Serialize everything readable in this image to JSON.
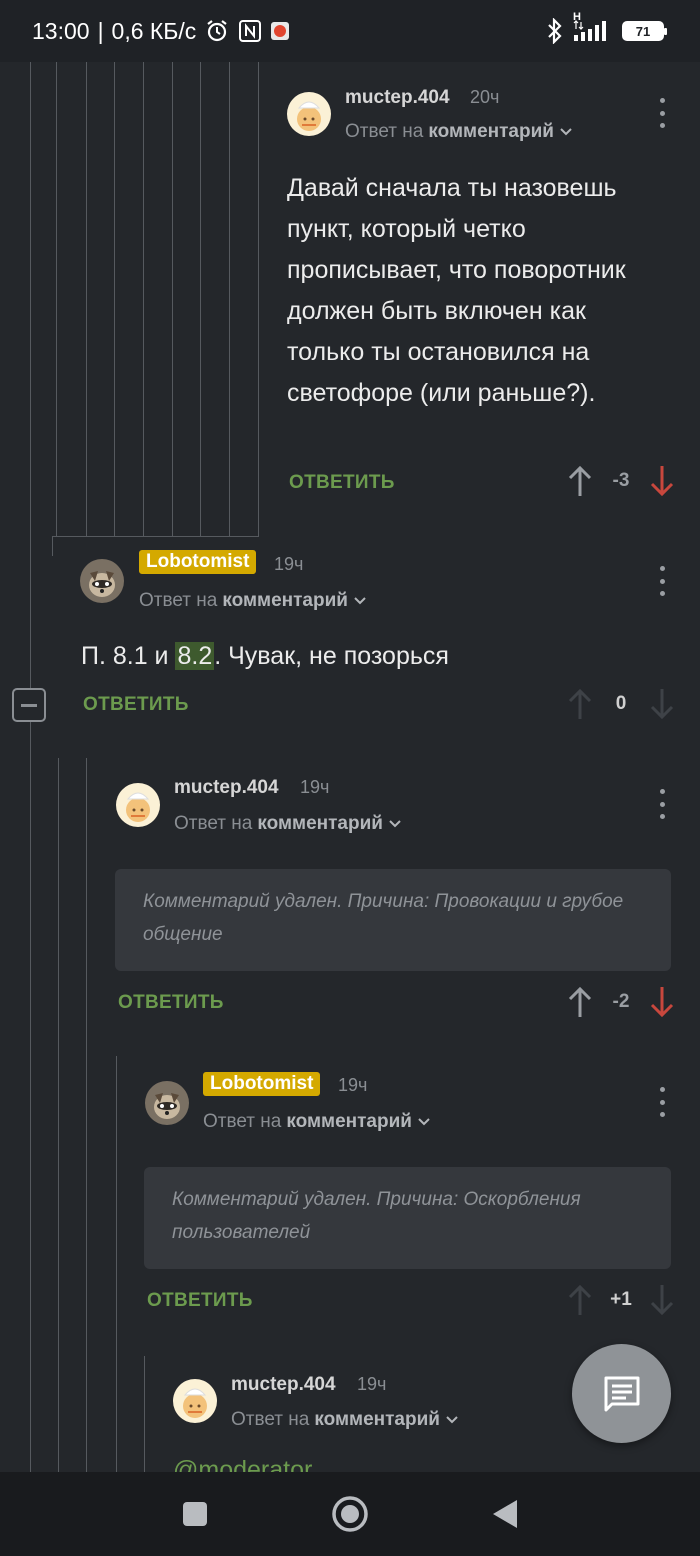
{
  "status_bar": {
    "time": "13:00",
    "network_speed": "0,6 КБ/с",
    "signal_label": "H",
    "battery": "71"
  },
  "comments": [
    {
      "username": "muctep.404",
      "time": "20ч",
      "reply_to_prefix": "Ответ на",
      "reply_to_link": "комментарий",
      "text": "Давай сначала ты назовешь пункт, который четко прописывает, что поворотник должен быть включен как только ты остановился на светофоре (или раньше?).",
      "reply_label": "ОТВЕТИТЬ",
      "score": "-3"
    },
    {
      "username": "Lobotomist",
      "time": "19ч",
      "reply_to_prefix": "Ответ на",
      "reply_to_link": "комментарий",
      "text_before": "П. 8.1 и ",
      "text_highlight": "8.2",
      "text_after": ". Чувак, не позорься",
      "reply_label": "ОТВЕТИТЬ",
      "score": "0"
    },
    {
      "username": "muctep.404",
      "time": "19ч",
      "reply_to_prefix": "Ответ на",
      "reply_to_link": "комментарий",
      "deleted_text": "Комментарий удален. Причина: Провокации и грубое общение",
      "reply_label": "ОТВЕТИТЬ",
      "score": "-2"
    },
    {
      "username": "Lobotomist",
      "time": "19ч",
      "reply_to_prefix": "Ответ на",
      "reply_to_link": "комментарий",
      "deleted_text": "Комментарий удален. Причина: Оскорбления пользователей",
      "reply_label": "ОТВЕТИТЬ",
      "score": "+1"
    },
    {
      "username": "muctep.404",
      "time": "19ч",
      "reply_to_prefix": "Ответ на",
      "reply_to_link": "комментарий",
      "partial_text": "@moderator"
    }
  ],
  "colors": {
    "background": "#24272b",
    "reply_green": "#6c9b4e",
    "downvote_red": "#c8473d",
    "badge_gold": "#d4a900"
  }
}
